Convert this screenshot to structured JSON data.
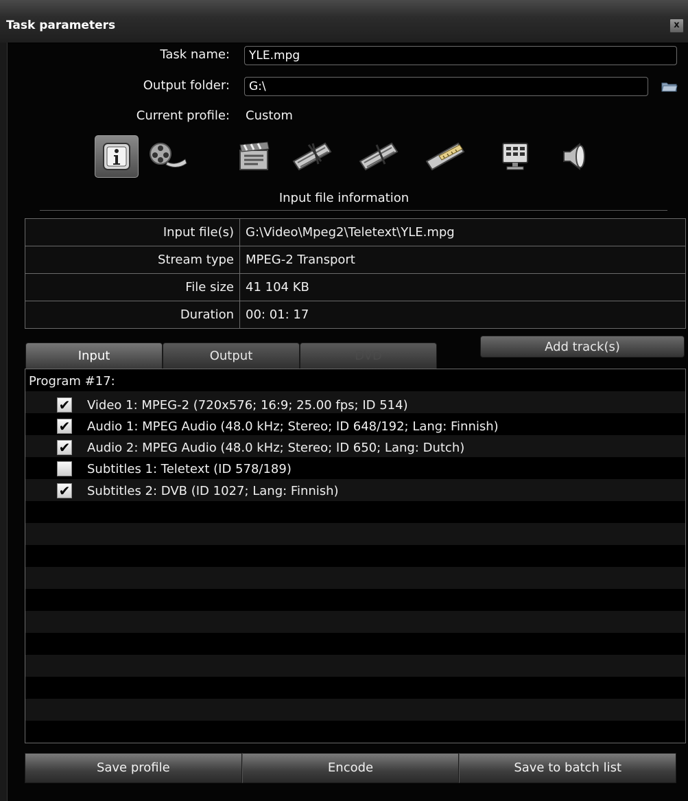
{
  "window": {
    "title": "Task parameters",
    "close_glyph": "x"
  },
  "form": {
    "task_name_label": "Task name:",
    "task_name_value": "YLE.mpg",
    "output_folder_label": "Output folder:",
    "output_folder_value": "G:\\",
    "current_profile_label": "Current profile:",
    "current_profile_value": "Custom"
  },
  "toolbar": {
    "icons": [
      "info-icon",
      "film-reel-icon",
      "film-clapper-icon",
      "film-cut-icon",
      "film-cut-icon",
      "film-ruler-icon",
      "monitor-icon",
      "speaker-icon"
    ],
    "section_caption": "Input file information"
  },
  "info_table": [
    {
      "key": "Input file(s)",
      "value": "G:\\Video\\Mpeg2\\Teletext\\YLE.mpg"
    },
    {
      "key": "Stream type",
      "value": "MPEG-2 Transport"
    },
    {
      "key": "File size",
      "value": "41 104 KB"
    },
    {
      "key": "Duration",
      "value": "00: 01: 17"
    }
  ],
  "tabs": [
    {
      "label": "Input",
      "state": "selected"
    },
    {
      "label": "Output",
      "state": "normal"
    },
    {
      "label": "DVD",
      "state": "disabled"
    }
  ],
  "add_tracks_label": "Add track(s)",
  "track_list": {
    "program_label": "Program #17:",
    "tracks": [
      {
        "label": "Video 1: MPEG-2  (720x576; 16:9; 25.00 fps; ID 514)",
        "checked": true
      },
      {
        "label": "Audio 1: MPEG Audio  (48.0 kHz; Stereo; ID 648/192; Lang: Finnish)",
        "checked": true
      },
      {
        "label": "Audio 2: MPEG Audio  (48.0 kHz; Stereo; ID 650; Lang: Dutch)",
        "checked": true
      },
      {
        "label": "Subtitles 1: Teletext  (ID 578/189)",
        "checked": false
      },
      {
        "label": "Subtitles 2: DVB  (ID 1027; Lang: Finnish)",
        "checked": true
      }
    ],
    "check_glyph": "✔"
  },
  "bottom_buttons": {
    "save_profile": "Save profile",
    "encode": "Encode",
    "save_batch": "Save to batch list"
  },
  "colors": {
    "background": "#050505",
    "text": "#f2f2f2",
    "border": "#6a6a6a"
  }
}
